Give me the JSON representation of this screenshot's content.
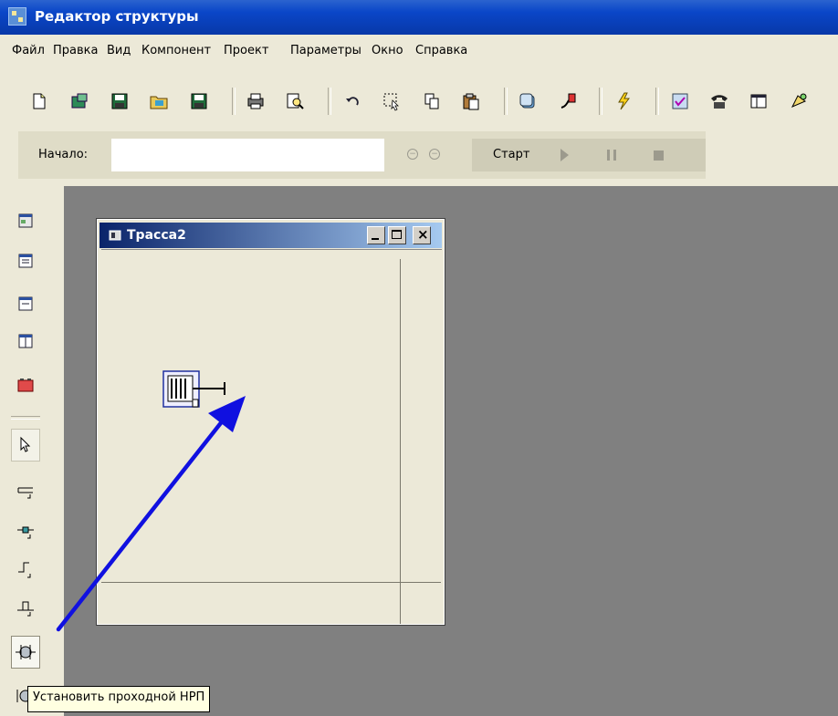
{
  "window": {
    "title": "Редактор структуры"
  },
  "menu": [
    "Файл",
    "Правка",
    "Вид",
    "Компонент",
    "Проект",
    "Параметры",
    "Окно",
    "Справка"
  ],
  "toolbar": {
    "buttons": [
      "new-file-icon",
      "open-icon",
      "save-icon",
      "open-project-icon",
      "save-as-icon",
      "print-icon",
      "preview-icon",
      "undo-icon",
      "select-icon",
      "copy-icon",
      "paste-icon",
      "component-icon",
      "color-icon",
      "run-check-icon",
      "check-icon",
      "phone-icon",
      "table-icon",
      "connect-icon"
    ]
  },
  "run_panel": {
    "start_label": "Начало:",
    "start_value": "",
    "start_button": "Старт"
  },
  "child_window": {
    "title": "Трасса2"
  },
  "tooltip": {
    "text": "Установить проходной НРП"
  },
  "colors": {
    "titlebar": "#0a46c8",
    "workspace": "#808080",
    "arrow": "#1010e0"
  }
}
